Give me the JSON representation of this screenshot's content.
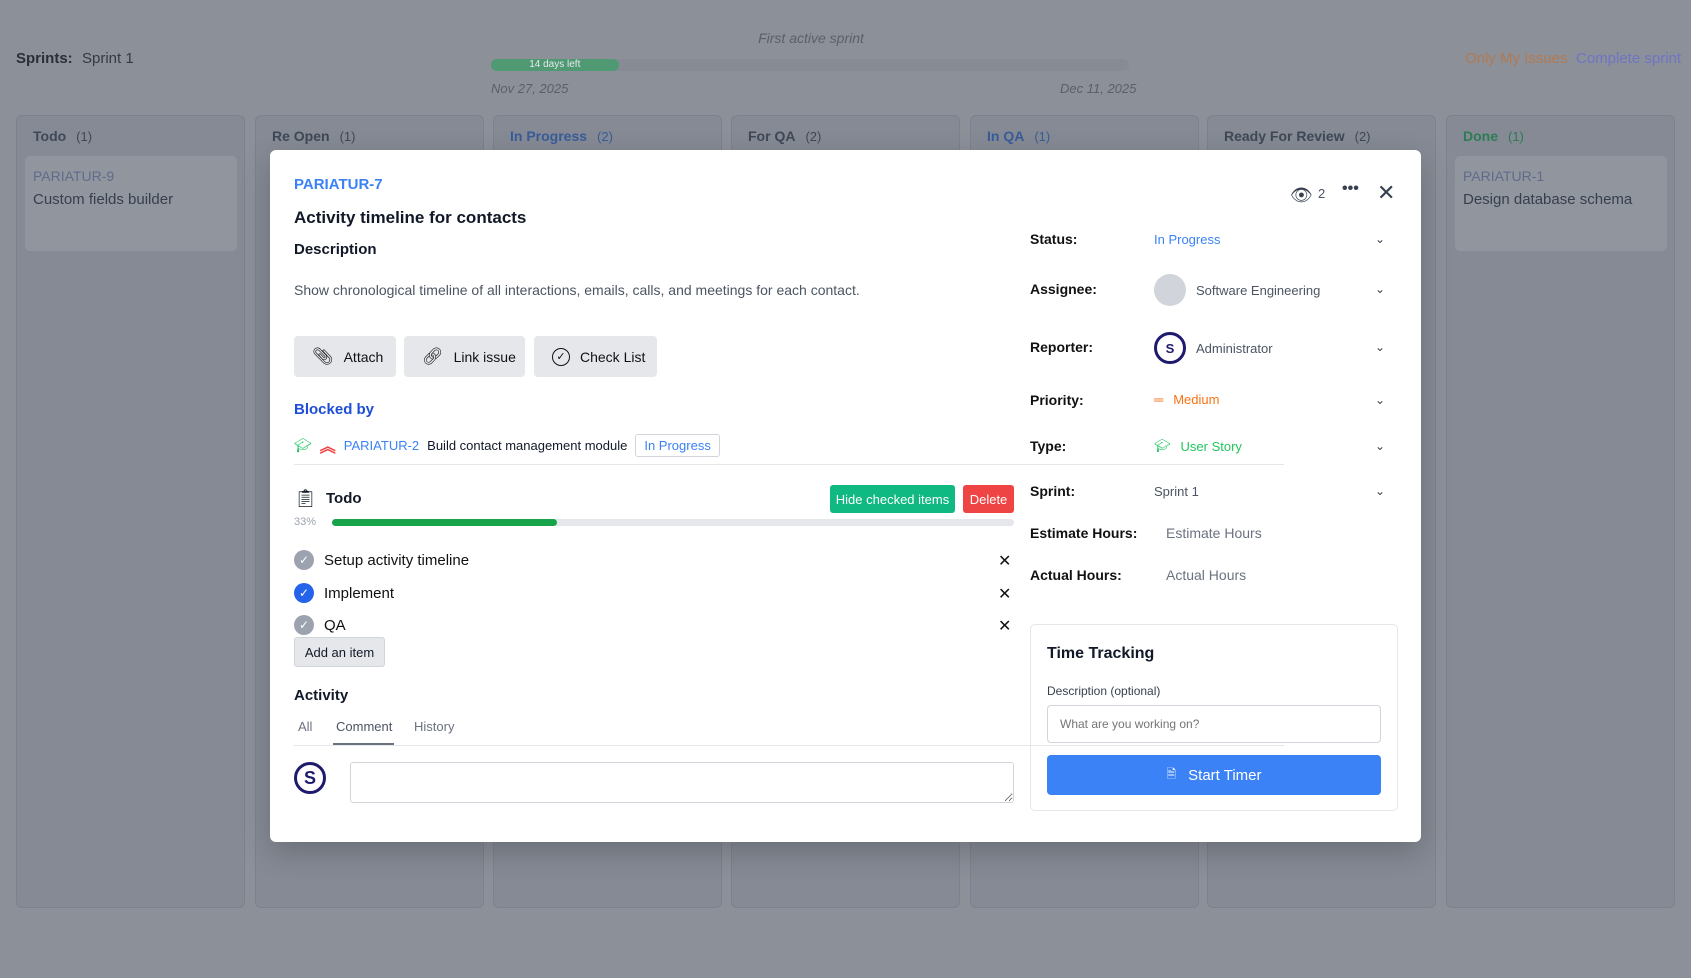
{
  "header": {
    "sprints_label": "Sprints:",
    "sprint_name": "Sprint 1",
    "sprint_goal": "First active sprint",
    "days_left": "14 days left",
    "progress_fraction": 0.2,
    "start_date": "Nov 27, 2025",
    "end_date": "Dec 11, 2025",
    "only_my_issues": "Only My Issues",
    "complete_sprint": "Complete sprint"
  },
  "columns": [
    {
      "title": "Todo",
      "count": "(1)",
      "color": "#4b5563",
      "card": {
        "key": "PARIATUR-9",
        "title": "Custom fields builder"
      }
    },
    {
      "title": "Re Open",
      "count": "(1)",
      "color": "#4b5563"
    },
    {
      "title": "In Progress",
      "count": "(2)",
      "color": "#3b82f6"
    },
    {
      "title": "For QA",
      "count": "(2)",
      "color": "#4b5563"
    },
    {
      "title": "In QA",
      "count": "(1)",
      "color": "#3b82f6"
    },
    {
      "title": "Ready For Review",
      "count": "(2)",
      "color": "#4b5563"
    },
    {
      "title": "Done",
      "count": "(1)",
      "color": "#22c55e",
      "card": {
        "key": "PARIATUR-1",
        "title": "Design database schema"
      }
    }
  ],
  "modal": {
    "key": "PARIATUR-7",
    "title": "Activity timeline for contacts",
    "description_label": "Description",
    "description": "Show chronological timeline of all interactions, emails, calls, and meetings for each contact.",
    "watchers": "2",
    "actions": {
      "attach": "Attach",
      "link": "Link issue",
      "checklist": "Check List"
    },
    "blocked_by": {
      "label": "Blocked by",
      "key": "PARIATUR-2",
      "title": "Build contact management module",
      "status": "In Progress"
    },
    "checklist": {
      "title": "Todo",
      "hide": "Hide checked items",
      "delete": "Delete",
      "percent": "33%",
      "progress": 0.33,
      "items": [
        {
          "text": "Setup activity timeline",
          "checked": false
        },
        {
          "text": "Implement",
          "checked": true
        },
        {
          "text": "QA",
          "checked": false
        }
      ],
      "add": "Add an item"
    },
    "activity": {
      "label": "Activity",
      "tabs": [
        "All",
        "Comment",
        "History"
      ],
      "active": "Comment"
    },
    "fields": {
      "status_l": "Status:",
      "status": "In Progress",
      "assignee_l": "Assignee:",
      "assignee": "Software Engineering",
      "reporter_l": "Reporter:",
      "reporter": "Administrator",
      "priority_l": "Priority:",
      "priority": "Medium",
      "type_l": "Type:",
      "type": "User Story",
      "sprint_l": "Sprint:",
      "sprint": "Sprint 1",
      "estimate_l": "Estimate Hours:",
      "estimate_ph": "Estimate Hours",
      "actual_l": "Actual Hours:",
      "actual_ph": "Actual Hours"
    },
    "time_tracking": {
      "title": "Time Tracking",
      "desc_label": "Description (optional)",
      "placeholder": "What are you working on?",
      "start": "Start Timer"
    }
  },
  "colors": {
    "accent": "#3b82f6",
    "green": "#10b981",
    "danger": "#ef4444",
    "priority": "#f97316"
  }
}
